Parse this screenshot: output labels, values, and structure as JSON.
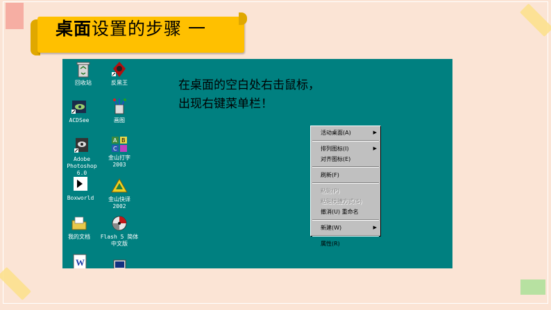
{
  "slide": {
    "title_bold": "桌面",
    "title_rest": "设置的步骤 一"
  },
  "desktop": {
    "instruction_line1": "在桌面的空白处右击鼠标，",
    "instruction_line2": "出现右键菜单栏！",
    "icons": [
      {
        "label": "回收站",
        "icon": "recycle-bin-icon"
      },
      {
        "label": "反黑王",
        "icon": "antivirus-icon"
      },
      {
        "label": "ACDSee",
        "icon": "acdsee-icon"
      },
      {
        "label": "画图",
        "icon": "paint-icon"
      },
      {
        "label": "Adobe\nPhotoshop\n6.0",
        "icon": "photoshop-icon"
      },
      {
        "label": "金山打字\n2003",
        "icon": "typing-tutor-icon"
      },
      {
        "label": "Boxworld",
        "icon": "boxworld-icon"
      },
      {
        "label": "金山快译\n2002",
        "icon": "kuaiyi-icon"
      },
      {
        "label": "我的文档",
        "icon": "my-documents-icon"
      },
      {
        "label": "Flash 5 简体\n中文版",
        "icon": "flash-icon"
      },
      {
        "label": "",
        "icon": "word-icon"
      },
      {
        "label": "",
        "icon": "computer-icon"
      }
    ]
  },
  "context_menu": {
    "items": [
      {
        "label": "活动桌面(A)",
        "submenu": true
      },
      {
        "label": "排列图标(I)",
        "submenu": true
      },
      {
        "label": "对齐图标(E)"
      },
      {
        "label": "刷新(F)"
      },
      {
        "label": "粘贴(P)",
        "disabled": true
      },
      {
        "label": "粘贴快捷方式(S)",
        "disabled": true
      },
      {
        "label": "撤消(U) 重命名"
      },
      {
        "label": "新建(W)",
        "submenu": true
      },
      {
        "label": "属性(R)"
      }
    ]
  },
  "colors": {
    "slide_bg": "#fbe4d5",
    "banner": "#ffc000",
    "desktop": "#008080",
    "menu": "#c0c0c0"
  }
}
